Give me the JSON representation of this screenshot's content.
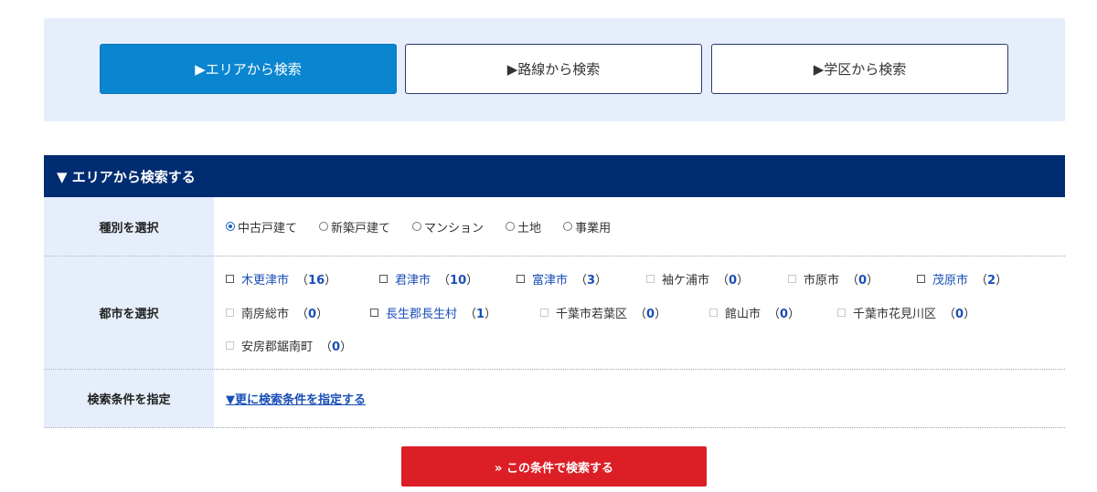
{
  "tabs": [
    {
      "label": "▶エリアから検索",
      "active": true
    },
    {
      "label": "▶路線から検索",
      "active": false
    },
    {
      "label": "▶学区から検索",
      "active": false
    }
  ],
  "section": {
    "title": "▼ エリアから検索する"
  },
  "type_row": {
    "label": "種別を選択",
    "options": [
      {
        "label": "中古戸建て",
        "checked": true
      },
      {
        "label": "新築戸建て",
        "checked": false
      },
      {
        "label": "マンション",
        "checked": false
      },
      {
        "label": "土地",
        "checked": false
      },
      {
        "label": "事業用",
        "checked": false
      }
    ]
  },
  "city_row": {
    "label": "都市を選択",
    "cities": [
      {
        "name": "木更津市",
        "count": "16",
        "enabled": true
      },
      {
        "name": "君津市",
        "count": "10",
        "enabled": true
      },
      {
        "name": "富津市",
        "count": "3",
        "enabled": true
      },
      {
        "name": "袖ケ浦市",
        "count": "0",
        "enabled": false
      },
      {
        "name": "市原市",
        "count": "0",
        "enabled": false
      },
      {
        "name": "茂原市",
        "count": "2",
        "enabled": true
      },
      {
        "name": "南房総市",
        "count": "0",
        "enabled": false
      },
      {
        "name": "長生郡長生村",
        "count": "1",
        "enabled": true
      },
      {
        "name": "千葉市若葉区",
        "count": "0",
        "enabled": false
      },
      {
        "name": "館山市",
        "count": "0",
        "enabled": false
      },
      {
        "name": "千葉市花見川区",
        "count": "0",
        "enabled": false
      },
      {
        "name": "安房郡鋸南町",
        "count": "0",
        "enabled": false
      }
    ]
  },
  "cond_row": {
    "label": "検索条件を指定",
    "link": "▼更に検索条件を指定する"
  },
  "search_button": "» この条件で検索する",
  "colors": {
    "accent": "#0a86d0",
    "header": "#002c71",
    "panel": "#e6eefb",
    "link": "#1a4fb8",
    "button": "#dc1e26"
  }
}
